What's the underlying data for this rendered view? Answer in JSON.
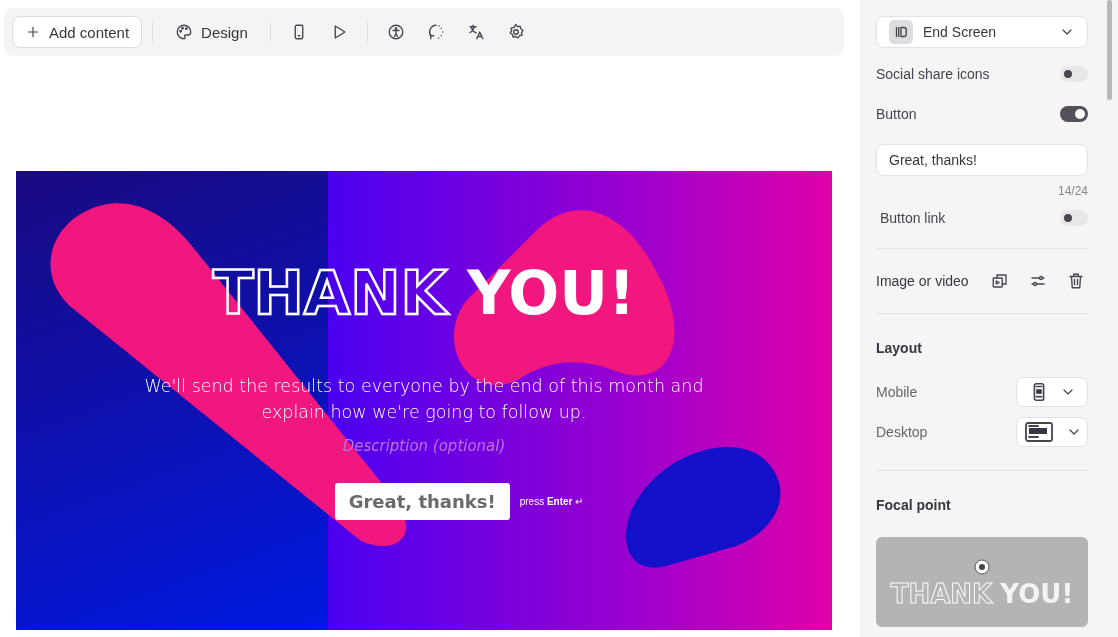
{
  "toolbar": {
    "add_button": "Add content",
    "design_button": "Design"
  },
  "preview": {
    "title_outline": "THANK",
    "title_filled": "YOU!",
    "message": "We'll send the results to everyone by the end of this month and explain how we're going to follow up.",
    "description_placeholder": "Description (optional)",
    "button": "Great, thanks!",
    "hint": "press **Enter** ↵"
  },
  "panel": {
    "screen_select": "End Screen",
    "toggles": [
      {
        "label": "Social share icons",
        "on": false
      },
      {
        "label": "Button",
        "on": true
      }
    ],
    "button_text": {
      "value": "Great, thanks!",
      "counter": "14/24"
    },
    "link_toggle": {
      "label": "Button link",
      "on": false
    },
    "media_label": "Image or video",
    "layout": {
      "title": "Layout",
      "rows": [
        {
          "kind": "mobile",
          "label": "Mobile"
        },
        {
          "kind": "desktop",
          "label": "Desktop"
        }
      ]
    },
    "focal": {
      "title": "Focal point",
      "title_outline": "THANK",
      "title_filled": "YOU!"
    }
  }
}
